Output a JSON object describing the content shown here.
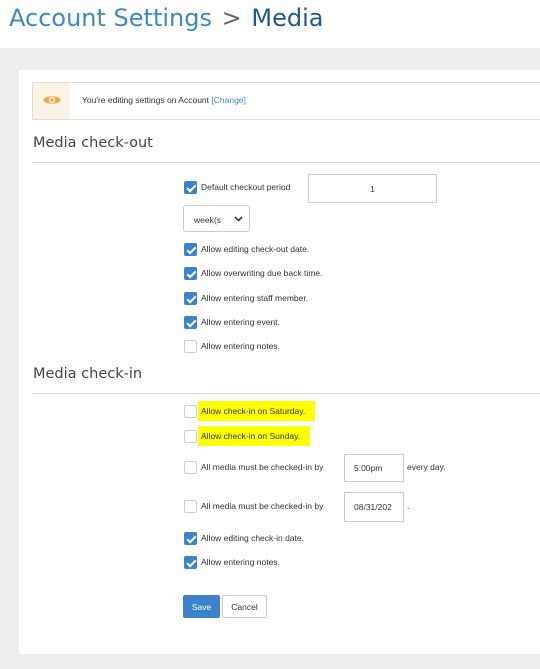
{
  "header": {
    "breadcrumb_parent": "Account Settings",
    "separator": ">",
    "breadcrumb_current": "Media"
  },
  "notice": {
    "icon": "eye-icon",
    "message": "You're editing settings on Account",
    "change_link": "[Change]"
  },
  "checkout": {
    "title": "Media check-out",
    "default_period_label": "Default checkout period",
    "default_period_checked": true,
    "default_period_value": "1",
    "period_unit": "week(s",
    "options": [
      {
        "label": "Allow editing check-out date.",
        "checked": true
      },
      {
        "label": "Allow overwriting due back time.",
        "checked": true
      },
      {
        "label": "Allow entering staff member.",
        "checked": true
      },
      {
        "label": "Allow entering event.",
        "checked": true
      },
      {
        "label": "Allow entering notes.",
        "checked": false
      }
    ]
  },
  "checkin": {
    "title": "Media check-in",
    "saturday_label": "Allow check-in on Saturday.",
    "saturday_checked": false,
    "sunday_label": "Allow check-in on Sunday.",
    "sunday_checked": false,
    "by_time_label": "All media must be checked-in by",
    "by_time_value": "5:00pm",
    "by_time_suffix": "every day.",
    "by_time_checked": false,
    "by_date_label": "All media must be checked-in by",
    "by_date_value": "08/31/202",
    "by_date_suffix": ".",
    "by_date_checked": false,
    "options": [
      {
        "label": "Allow editing check-in date.",
        "checked": true
      },
      {
        "label": "Allow entering notes.",
        "checked": true
      }
    ]
  },
  "actions": {
    "save_label": "Save",
    "cancel_label": "Cancel"
  },
  "colors": {
    "accent": "#3b83cc",
    "highlight": "#ffff00",
    "title_blue": "#3d88c6"
  }
}
